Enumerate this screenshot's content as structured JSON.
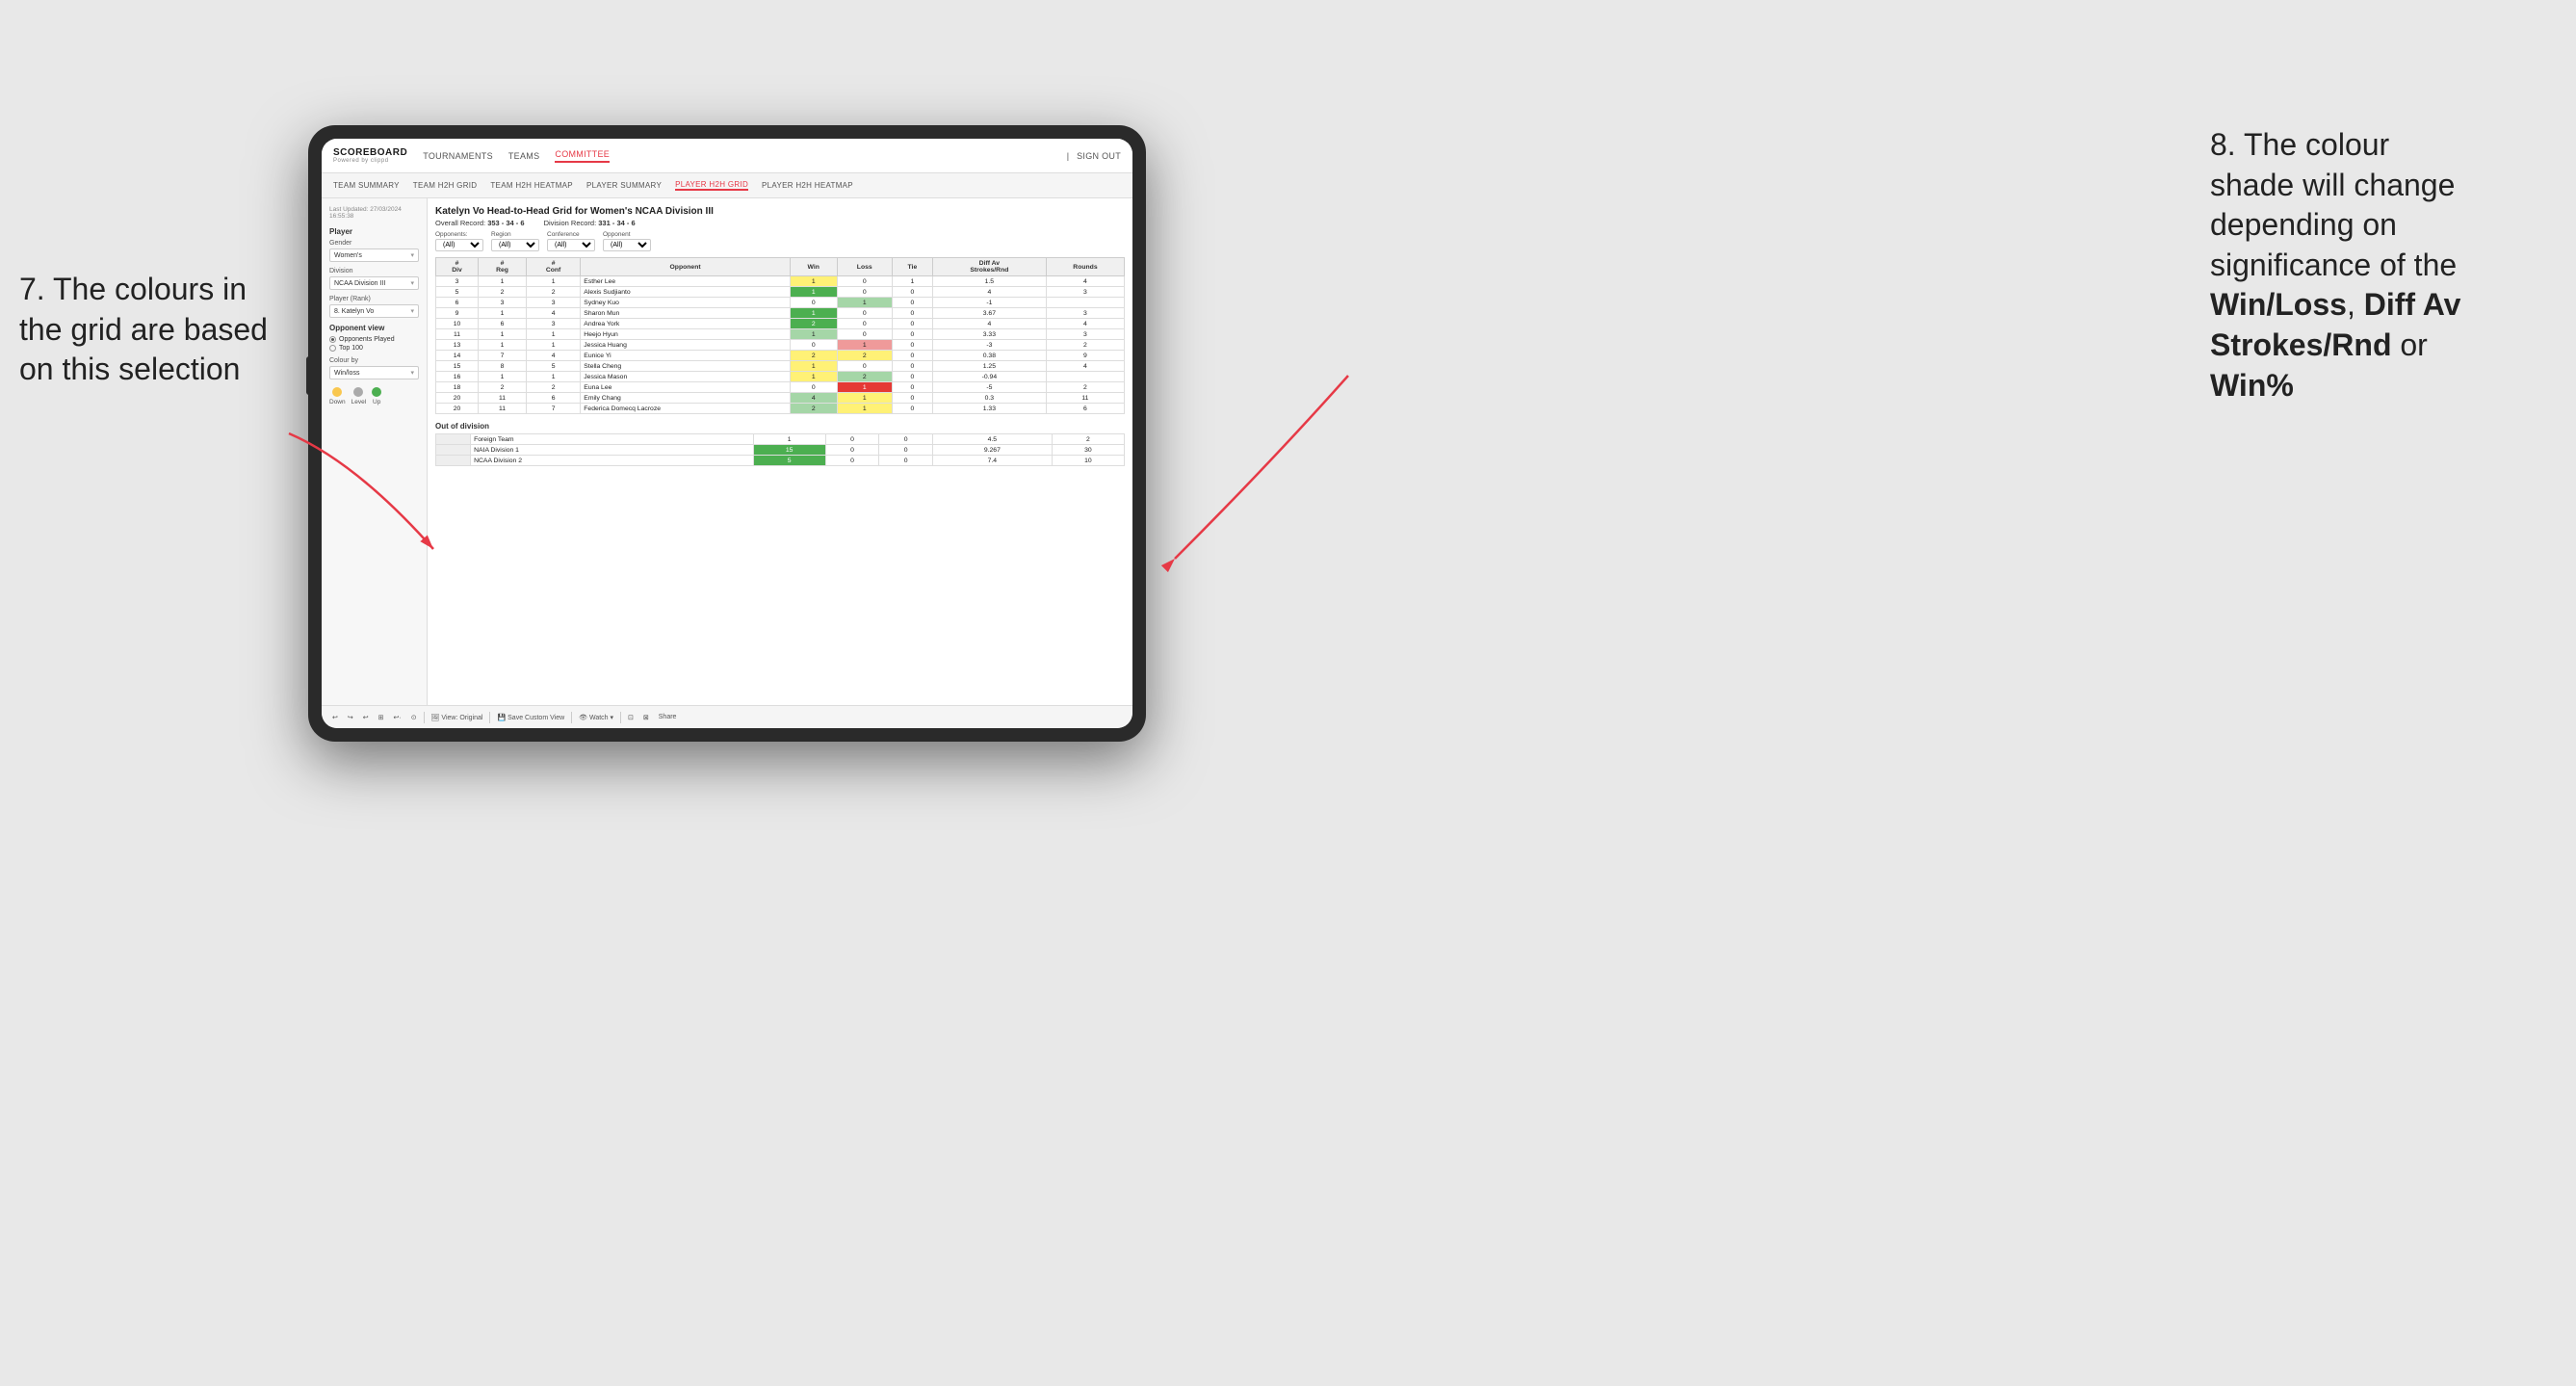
{
  "annotations": {
    "left": {
      "line1": "7. The colours in",
      "line2": "the grid are based",
      "line3": "on this selection"
    },
    "right": {
      "line1": "8. The colour",
      "line2": "shade will change",
      "line3": "depending on",
      "line4": "significance of the",
      "bold1": "Win/Loss",
      "comma1": ", ",
      "bold2": "Diff Av",
      "line5": "Strokes/Rnd",
      "line6": " or",
      "bold3": "Win%"
    }
  },
  "nav": {
    "logo": "SCOREBOARD",
    "logo_sub": "Powered by clippd",
    "items": [
      "TOURNAMENTS",
      "TEAMS",
      "COMMITTEE"
    ],
    "active_item": "COMMITTEE",
    "right": [
      "Sign out"
    ]
  },
  "sub_nav": {
    "items": [
      "TEAM SUMMARY",
      "TEAM H2H GRID",
      "TEAM H2H HEATMAP",
      "PLAYER SUMMARY",
      "PLAYER H2H GRID",
      "PLAYER H2H HEATMAP"
    ],
    "active": "PLAYER H2H GRID"
  },
  "left_panel": {
    "last_updated_label": "Last Updated: 27/03/2024",
    "last_updated_time": "16:55:38",
    "player_section": "Player",
    "gender_label": "Gender",
    "gender_value": "Women's",
    "division_label": "Division",
    "division_value": "NCAA Division III",
    "player_rank_label": "Player (Rank)",
    "player_rank_value": "8. Katelyn Vo",
    "opponent_view_label": "Opponent view",
    "opponents_played": "Opponents Played",
    "top_100": "Top 100",
    "colour_by_label": "Colour by",
    "colour_by_value": "Win/loss",
    "legend": {
      "down_label": "Down",
      "level_label": "Level",
      "up_label": "Up"
    }
  },
  "main": {
    "title": "Katelyn Vo Head-to-Head Grid for Women's NCAA Division III",
    "overall_record_label": "Overall Record:",
    "overall_record": "353 - 34 - 6",
    "division_record_label": "Division Record:",
    "division_record": "331 - 34 - 6",
    "filters": {
      "opponents_label": "Opponents:",
      "opponents_value": "(All)",
      "region_label": "Region",
      "region_value": "(All)",
      "conference_label": "Conference",
      "conference_value": "(All)",
      "opponent_label": "Opponent",
      "opponent_value": "(All)"
    },
    "table_headers": [
      "#Div",
      "#Reg",
      "#Conf",
      "Opponent",
      "Win",
      "Loss",
      "Tie",
      "Diff Av Strokes/Rnd",
      "Rounds"
    ],
    "rows": [
      {
        "div": 3,
        "reg": 1,
        "conf": 1,
        "opponent": "Esther Lee",
        "win": 1,
        "loss": 0,
        "tie": 1,
        "diff": 1.5,
        "rounds": 4,
        "win_color": "yellow",
        "loss_color": "white"
      },
      {
        "div": 5,
        "reg": 2,
        "conf": 2,
        "opponent": "Alexis Sudjianto",
        "win": 1,
        "loss": 0,
        "tie": 0,
        "diff": 4.0,
        "rounds": 3,
        "win_color": "green-dark",
        "loss_color": "white"
      },
      {
        "div": 6,
        "reg": 3,
        "conf": 3,
        "opponent": "Sydney Kuo",
        "win": 0,
        "loss": 1,
        "tie": 0,
        "diff": -1.0,
        "rounds": "",
        "win_color": "white",
        "loss_color": "green-light"
      },
      {
        "div": 9,
        "reg": 1,
        "conf": 4,
        "opponent": "Sharon Mun",
        "win": 1,
        "loss": 0,
        "tie": 0,
        "diff": 3.67,
        "rounds": 3,
        "win_color": "green-dark",
        "loss_color": "white"
      },
      {
        "div": 10,
        "reg": 6,
        "conf": 3,
        "opponent": "Andrea York",
        "win": 2,
        "loss": 0,
        "tie": 0,
        "diff": 4.0,
        "rounds": 4,
        "win_color": "green-dark",
        "loss_color": "white"
      },
      {
        "div": 11,
        "reg": 1,
        "conf": 1,
        "opponent": "Heejo Hyun",
        "win": 1,
        "loss": 0,
        "tie": 0,
        "diff": 3.33,
        "rounds": 3,
        "win_color": "green-light",
        "loss_color": "white"
      },
      {
        "div": 13,
        "reg": 1,
        "conf": 1,
        "opponent": "Jessica Huang",
        "win": 0,
        "loss": 1,
        "tie": 0,
        "diff": -3.0,
        "rounds": 2,
        "win_color": "white",
        "loss_color": "red-light"
      },
      {
        "div": 14,
        "reg": 7,
        "conf": 4,
        "opponent": "Eunice Yi",
        "win": 2,
        "loss": 2,
        "tie": 0,
        "diff": 0.38,
        "rounds": 9,
        "win_color": "yellow",
        "loss_color": "yellow"
      },
      {
        "div": 15,
        "reg": 8,
        "conf": 5,
        "opponent": "Stella Cheng",
        "win": 1,
        "loss": 0,
        "tie": 0,
        "diff": 1.25,
        "rounds": 4,
        "win_color": "yellow",
        "loss_color": "white"
      },
      {
        "div": 16,
        "reg": 1,
        "conf": 1,
        "opponent": "Jessica Mason",
        "win": 1,
        "loss": 2,
        "tie": 0,
        "diff": -0.94,
        "rounds": "",
        "win_color": "yellow",
        "loss_color": "green-light"
      },
      {
        "div": 18,
        "reg": 2,
        "conf": 2,
        "opponent": "Euna Lee",
        "win": 0,
        "loss": 1,
        "tie": 0,
        "diff": -5.0,
        "rounds": 2,
        "win_color": "white",
        "loss_color": "red-dark"
      },
      {
        "div": 20,
        "reg": 11,
        "conf": 6,
        "opponent": "Emily Chang",
        "win": 4,
        "loss": 1,
        "tie": 0,
        "diff": 0.3,
        "rounds": 11,
        "win_color": "green-light",
        "loss_color": "yellow"
      },
      {
        "div": 20,
        "reg": 11,
        "conf": 7,
        "opponent": "Federica Domecq Lacroze",
        "win": 2,
        "loss": 1,
        "tie": 0,
        "diff": 1.33,
        "rounds": 6,
        "win_color": "green-light",
        "loss_color": "yellow"
      }
    ],
    "out_of_division": {
      "title": "Out of division",
      "rows": [
        {
          "opponent": "Foreign Team",
          "win": 1,
          "loss": 0,
          "tie": 0,
          "diff": 4.5,
          "rounds": 2,
          "win_color": "white",
          "loss_color": "white"
        },
        {
          "opponent": "NAIA Division 1",
          "win": 15,
          "loss": 0,
          "tie": 0,
          "diff": 9.267,
          "rounds": 30,
          "win_color": "green-dark",
          "loss_color": "white"
        },
        {
          "opponent": "NCAA Division 2",
          "win": 5,
          "loss": 0,
          "tie": 0,
          "diff": 7.4,
          "rounds": 10,
          "win_color": "green-dark",
          "loss_color": "white"
        }
      ]
    }
  },
  "toolbar": {
    "buttons": [
      "↩",
      "↪",
      "↩",
      "⊞",
      "↩",
      "·",
      "⊙",
      "|",
      "View: Original",
      "|",
      "Save Custom View",
      "|",
      "Watch ▾",
      "|",
      "⊡",
      "⊠",
      "Share"
    ]
  }
}
